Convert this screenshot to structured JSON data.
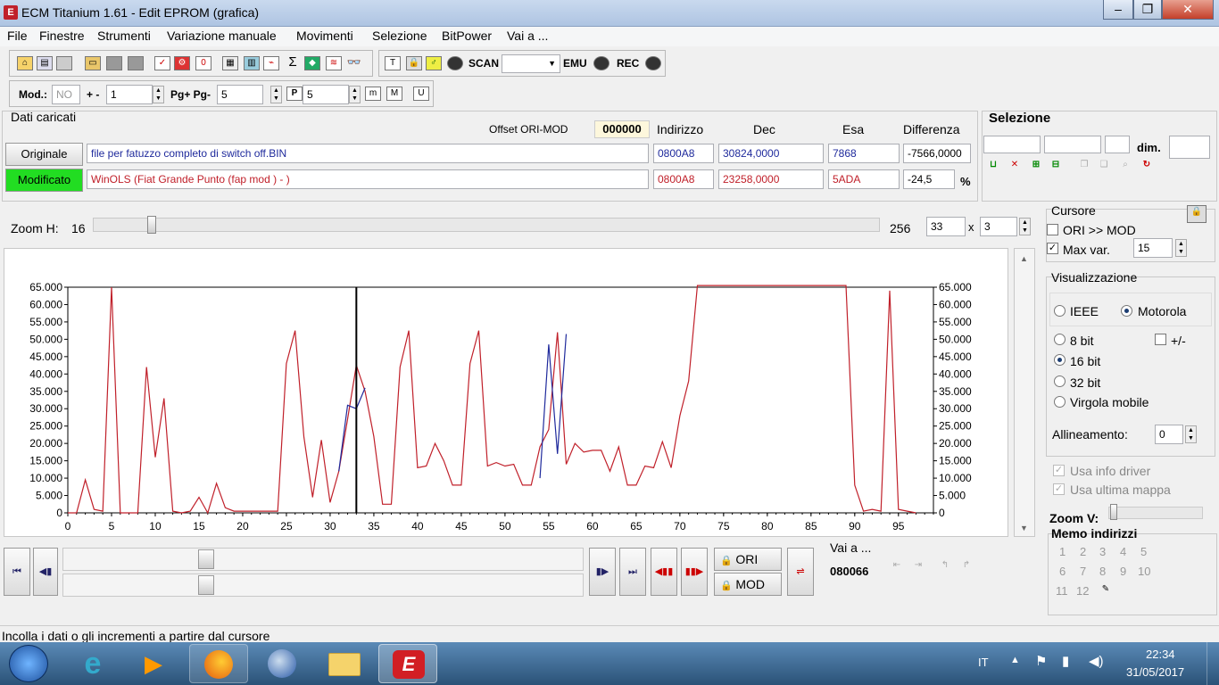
{
  "window": {
    "title": "ECM Titanium 1.61 - Edit EPROM (grafica)",
    "minimize": "–",
    "maximize": "❐",
    "close": "✕"
  },
  "menu": [
    "File",
    "Finestre",
    "Strumenti",
    "Variazione manuale",
    "Movimenti",
    "Selezione",
    "BitPower",
    "Vai a ..."
  ],
  "toolbar2": {
    "scan": "SCAN",
    "emu": "EMU",
    "rec": "REC"
  },
  "toolbar3": {
    "mod_label": "Mod.:",
    "mod_value": "NO",
    "step_label": "+ -",
    "step_value": "1",
    "pg_label": "Pg+ Pg-",
    "pg_value": "5",
    "p_value": "5"
  },
  "dati": {
    "title": "Dati caricati",
    "offset_label": "Offset ORI-MOD",
    "offset_value": "000000",
    "headers": {
      "indirizzo": "Indirizzo",
      "dec": "Dec",
      "esa": "Esa",
      "diff": "Differenza"
    },
    "originale": {
      "label": "Originale",
      "file": "file per fatuzzo completo di switch off.BIN",
      "addr": "0800A8",
      "dec": "30824,0000",
      "esa": "7868",
      "diff": "-7566,0000"
    },
    "modificato": {
      "label": "Modificato",
      "file": "WinOLS (Fiat Grande Punto (fap mod ) - )",
      "addr": "0800A8",
      "dec": "23258,0000",
      "esa": "5ADA",
      "diff": "-24,5",
      "pct": "%"
    }
  },
  "selezione": {
    "title": "Selezione",
    "dim": "dim."
  },
  "zoom": {
    "label": "Zoom H:",
    "value": "16",
    "max": "256",
    "w": "33",
    "x": "x",
    "h": "3"
  },
  "cursore": {
    "title": "Cursore",
    "ori_mod": "ORI >> MOD",
    "maxvar": "Max var.",
    "maxvar_value": "15"
  },
  "visual": {
    "title": "Visualizzazione",
    "ieee": "IEEE",
    "motorola": "Motorola",
    "bit8": "8 bit",
    "pm": "+/-",
    "bit16": "16 bit",
    "bit32": "32 bit",
    "virgola": "Virgola mobile",
    "allineamento": "Allineamento:",
    "all_value": "0",
    "usa_info": "Usa info driver",
    "usa_mappa": "Usa ultima mappa",
    "zoomv": "Zoom V:"
  },
  "memo": {
    "title": "Memo indirizzi",
    "nums": [
      "1",
      "2",
      "3",
      "4",
      "5",
      "6",
      "7",
      "8",
      "9",
      "10",
      "11",
      "12"
    ]
  },
  "bottom": {
    "ori": "ORI",
    "mod": "MOD",
    "vai_label": "Vai a ...",
    "vai_value": "080066"
  },
  "status": "Incolla i dati o gli incrementi a partire dal cursore",
  "tray": {
    "lang": "IT",
    "time": "22:34",
    "date": "31/05/2017"
  },
  "colors": {
    "ori": "#1f2a9c",
    "mod": "#c0202a",
    "highlight": "#22dd22"
  },
  "chart_data": {
    "type": "line",
    "ylim": [
      0,
      65000
    ],
    "xlim": [
      0,
      99
    ],
    "x_ticks": [
      "0",
      "5",
      "10",
      "15",
      "20",
      "25",
      "30",
      "35",
      "40",
      "45",
      "50",
      "55",
      "60",
      "65",
      "70",
      "75",
      "80",
      "85",
      "90",
      "95"
    ],
    "y_ticks": [
      "0",
      "5.000",
      "10.000",
      "15.000",
      "20.000",
      "25.000",
      "30.000",
      "35.000",
      "40.000",
      "45.000",
      "50.000",
      "55.000",
      "60.000",
      "65.000"
    ],
    "cursor_x": 33,
    "series": [
      {
        "color": "#c0202a",
        "values": [
          0,
          0,
          9500,
          1000,
          500,
          65000,
          0,
          0,
          0,
          42000,
          16000,
          33000,
          500,
          0,
          500,
          4500,
          0,
          8500,
          1500,
          500,
          500,
          500,
          500,
          500,
          500,
          43000,
          52500,
          22000,
          4500,
          21000,
          3000,
          12000,
          27000,
          42500,
          35000,
          22000,
          2500,
          2500,
          42000,
          52500,
          13000,
          13500,
          20000,
          15000,
          8000,
          8000,
          43000,
          52500,
          13500,
          14500,
          13500,
          14000,
          8000,
          8000,
          19000,
          24000,
          52000,
          14000,
          20000,
          17500,
          18000,
          18000,
          12000,
          19000,
          8000,
          8000,
          13500,
          13000,
          20500,
          13000,
          28000,
          38000,
          65500,
          65500,
          65500,
          65500,
          65500,
          65500,
          65500,
          65500,
          65500,
          65500,
          65500,
          65500,
          65500,
          65500,
          65500,
          65500,
          65500,
          65500,
          8000,
          500,
          1000,
          500,
          64000,
          1000,
          500,
          0
        ]
      },
      {
        "color": "#1f2a9c",
        "values": [
          null,
          null,
          null,
          null,
          null,
          null,
          null,
          null,
          null,
          null,
          null,
          null,
          null,
          null,
          null,
          null,
          null,
          null,
          null,
          null,
          null,
          null,
          null,
          null,
          null,
          null,
          null,
          null,
          null,
          null,
          null,
          12000,
          31000,
          30000,
          36000,
          null,
          null,
          null,
          null,
          null,
          null,
          null,
          null,
          null,
          null,
          null,
          null,
          null,
          null,
          null,
          null,
          null,
          null,
          null,
          10000,
          48500,
          17000,
          51500,
          null
        ]
      }
    ]
  }
}
